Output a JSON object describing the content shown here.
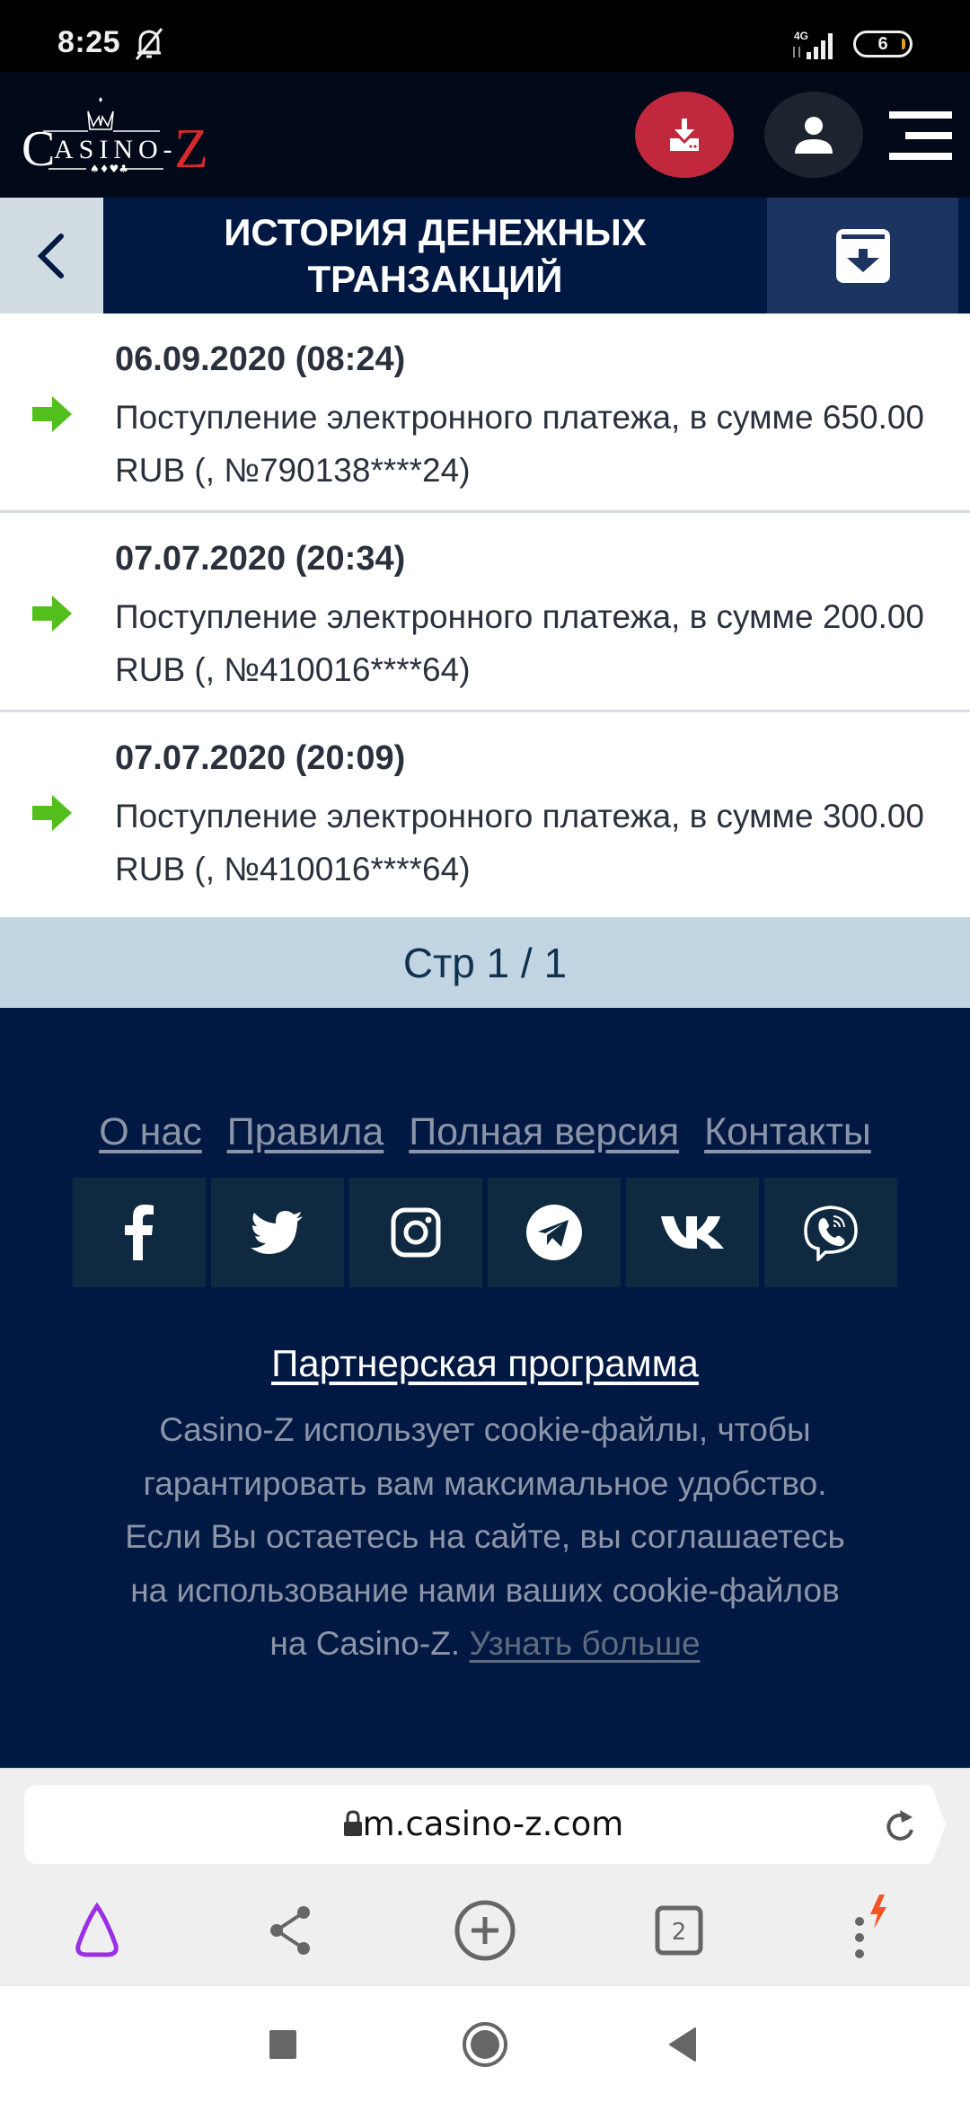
{
  "status_bar": {
    "time": "8:25",
    "network": "4G",
    "battery": "6",
    "icons": [
      "bell-off-icon",
      "signal-icon",
      "battery-icon"
    ]
  },
  "header": {
    "logo_text": "Casino-Z",
    "buttons": [
      {
        "name": "deposit",
        "icon": "download-icon"
      },
      {
        "name": "profile",
        "icon": "user-icon"
      },
      {
        "name": "menu",
        "icon": "hamburger-icon"
      }
    ],
    "colors": {
      "deposit": "#c1283e",
      "profile": "#1d2430",
      "background": "#020a19"
    }
  },
  "titlebar": {
    "title": "История денежных транзакций",
    "back_icon": "chevron-left-icon",
    "archive_icon": "archive-download-icon"
  },
  "transactions": [
    {
      "date": "06.09.2020 (08:24)",
      "description": "Поступление электронного платежа, в сумме 650.00 RUB (, №790138****24)",
      "direction": "incoming",
      "icon": "arrow-right-icon"
    },
    {
      "date": "07.07.2020 (20:34)",
      "description": "Поступление электронного платежа, в сумме 200.00 RUB (, №410016****64)",
      "direction": "incoming",
      "icon": "arrow-right-icon"
    },
    {
      "date": "07.07.2020 (20:09)",
      "description": "Поступление электронного платежа, в сумме 300.00 RUB (, №410016****64)",
      "direction": "incoming",
      "icon": "arrow-right-icon"
    }
  ],
  "pagination": {
    "label": "Стр 1 / 1",
    "current": 1,
    "total": 1
  },
  "footer": {
    "links": [
      "О нас",
      "Правила",
      "Полная версия",
      "Контакты"
    ],
    "social": [
      "facebook",
      "twitter",
      "instagram",
      "telegram",
      "vk",
      "viber"
    ],
    "partner_link": "Партнерская программа",
    "cookie_text": "Casino-Z использует cookie-файлы, чтобы гарантировать вам максимальное удобство. Если Вы остаетесь на сайте, вы соглашаетесь на использование нами ваших cookie-файлов на Casino-Z.",
    "cookie_link": "Узнать больше"
  },
  "browser": {
    "url": "m.casino-z.com",
    "tab_count": "2",
    "toolbar": [
      "alice-icon",
      "share-icon",
      "new-tab-icon",
      "tabs-icon",
      "more-icon"
    ]
  },
  "nav_bar": [
    "recents-icon",
    "home-icon",
    "back-icon"
  ],
  "colors": {
    "accent_green": "#52bf1c",
    "title_bg": "#011942",
    "archive_bg": "#1b3462",
    "pagination_bg": "#c2d5e3",
    "footer_bg": "#011942",
    "social_tile_bg": "#0f2940"
  }
}
